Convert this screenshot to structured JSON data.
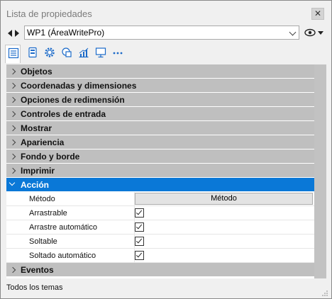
{
  "window": {
    "title": "Lista de propiedades",
    "close_glyph": "✕"
  },
  "object_selector": {
    "value": "WP1 (ÁreaWritePro)"
  },
  "toolbar": {
    "icons": [
      "list-icon",
      "form-icon",
      "gear-icon",
      "shapes-icon",
      "chart-icon",
      "monitor-icon",
      "more-icon"
    ]
  },
  "categories": [
    {
      "label": "Objetos"
    },
    {
      "label": "Coordenadas y dimensiones"
    },
    {
      "label": "Opciones de redimensión"
    },
    {
      "label": "Controles de entrada"
    },
    {
      "label": "Mostrar"
    },
    {
      "label": "Apariencia"
    },
    {
      "label": "Fondo y borde"
    },
    {
      "label": "Imprimir"
    },
    {
      "label": "Acción",
      "expanded": true,
      "selected": true
    },
    {
      "label": "Eventos"
    }
  ],
  "action_properties": [
    {
      "label": "Método",
      "type": "button",
      "value": "Método"
    },
    {
      "label": "Arrastrable",
      "type": "checkbox",
      "checked": true
    },
    {
      "label": "Arrastre automático",
      "type": "checkbox",
      "checked": true
    },
    {
      "label": "Soltable",
      "type": "checkbox",
      "checked": true
    },
    {
      "label": "Soltado automático",
      "type": "checkbox",
      "checked": true
    }
  ],
  "status": {
    "text": "Todos los temas"
  },
  "colors": {
    "selection": "#0a78d7",
    "category_bg": "#bfbfbf"
  }
}
